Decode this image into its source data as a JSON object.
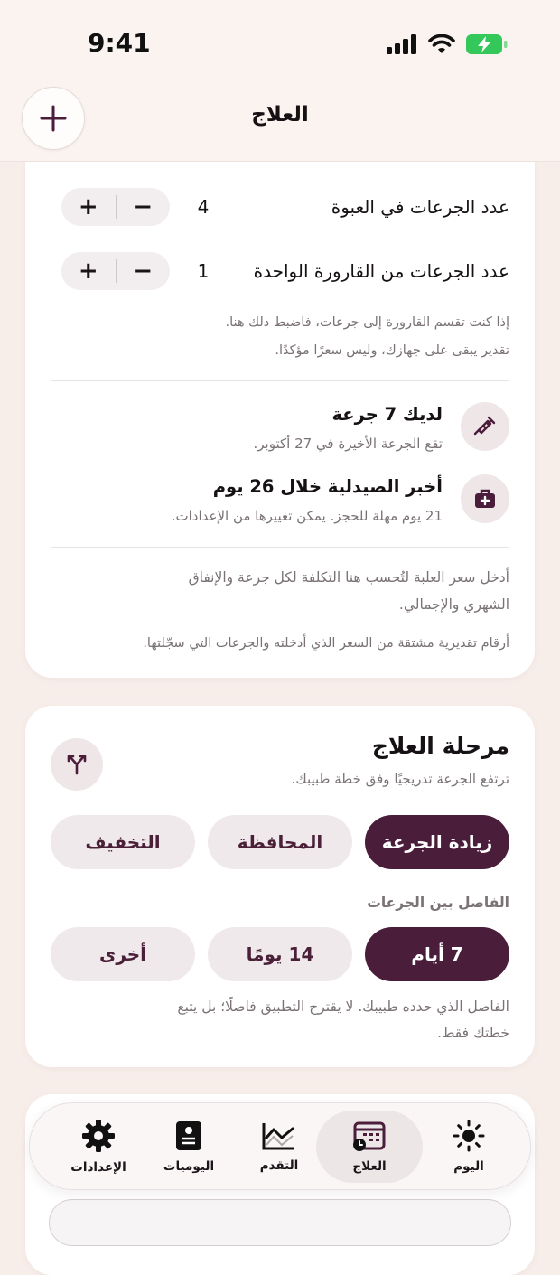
{
  "status_bar": {
    "time": "9:41"
  },
  "header": {
    "title": "العلاج"
  },
  "card_counts": {
    "rows": [
      {
        "label": "عدد الجرعات في العبوة",
        "value": "4"
      },
      {
        "label": "عدد الجرعات من القارورة الواحدة",
        "value": "1"
      }
    ],
    "note_line1": "إذا كنت تقسم القارورة إلى جرعات، فاضبط ذلك هنا.",
    "note_line2": "تقدير يبقى على جهازك، وليس سعرًا مؤكدًا.",
    "doses_title": "لديك 7 جرعة",
    "doses_sub": "تقع الجرعة الأخيرة في 27 أكتوبر.",
    "pharmacy_title": "أخبر الصيدلية خلال 26 يوم",
    "pharmacy_sub": "21 يوم مهلة للحجز. يمكن تغييرها من الإعدادات.",
    "price_note_line1": "أدخل سعر العلبة لتُحسب هنا التكلفة لكل جرعة والإنفاق",
    "price_note_line2": "الشهري والإجمالي.",
    "estimate_note": "أرقام تقديرية مشتقة من السعر الذي أدخلته والجرعات التي سجّلتها."
  },
  "phase_card": {
    "title": "مرحلة العلاج",
    "subtitle": "ترتفع الجرعة تدريجيًا وفق خطة طبيبك.",
    "phases": [
      "زيادة الجرعة",
      "المحافظة",
      "التخفيف"
    ],
    "active_phase": 0,
    "interval_label": "الفاصل بين الجرعات",
    "intervals": [
      "7 أيام",
      "14 يومًا",
      "أخرى"
    ],
    "active_interval": 0,
    "note_line1": "الفاصل الذي حدده طبيبك. لا يقترح التطبيق فاصلًا؛ بل يتبع",
    "note_line2": "خطتك فقط."
  },
  "tabbar": {
    "tabs": [
      {
        "label": "اليوم",
        "icon": "sun-icon"
      },
      {
        "label": "العلاج",
        "icon": "calendar-clock-icon"
      },
      {
        "label": "التقدم",
        "icon": "chart-line-icon"
      },
      {
        "label": "اليوميات",
        "icon": "journal-icon"
      },
      {
        "label": "الإعدادات",
        "icon": "gear-icon"
      }
    ],
    "active": 1
  },
  "colors": {
    "accent": "#4a1d3a",
    "pill": "#f0e9eb",
    "background": "#f7eeea"
  }
}
